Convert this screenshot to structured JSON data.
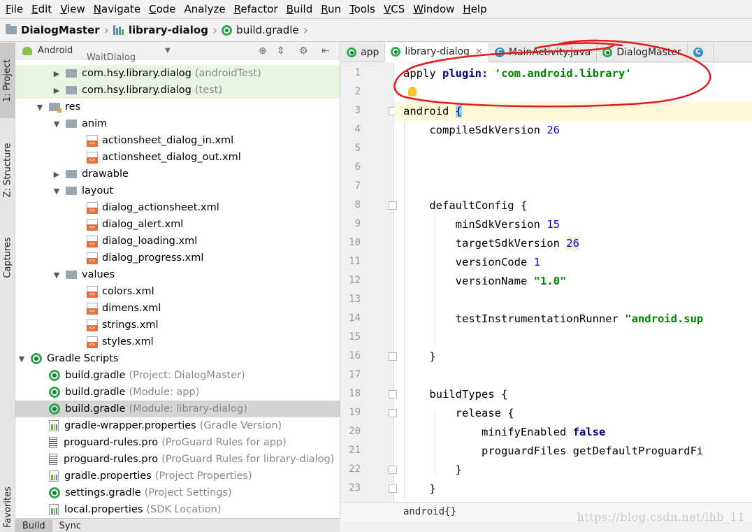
{
  "menu": [
    {
      "label": "File",
      "mnemonic": "F",
      "rest": "ile"
    },
    {
      "label": "Edit",
      "mnemonic": "E",
      "rest": "dit"
    },
    {
      "label": "View",
      "mnemonic": "V",
      "rest": "iew"
    },
    {
      "label": "Navigate",
      "mnemonic": "N",
      "rest": "avigate"
    },
    {
      "label": "Code",
      "mnemonic": "C",
      "rest": "ode"
    },
    {
      "label": "Analyze",
      "mnemonic": "",
      "rest": "Analyze"
    },
    {
      "label": "Refactor",
      "mnemonic": "R",
      "rest": "efactor"
    },
    {
      "label": "Build",
      "mnemonic": "B",
      "rest": "uild"
    },
    {
      "label": "Run",
      "mnemonic": "R",
      "rest": "un"
    },
    {
      "label": "Tools",
      "mnemonic": "T",
      "rest": "ools"
    },
    {
      "label": "VCS",
      "mnemonic": "V",
      "rest": "CS"
    },
    {
      "label": "Window",
      "mnemonic": "W",
      "rest": "indow"
    },
    {
      "label": "Help",
      "mnemonic": "H",
      "rest": "elp"
    }
  ],
  "breadcrumb": {
    "project": "DialogMaster",
    "module": "library-dialog",
    "file": "build.gradle"
  },
  "tool_strip": {
    "project": "1: Project",
    "structure": "Z: Structure",
    "captures": "Captures",
    "favorites": "Favorites"
  },
  "project_panel": {
    "view_mode": "Android",
    "partial_top_item": "WaitDialog",
    "tree": [
      {
        "label": "com.hsy.library.dialog",
        "hint": "(androidTest)",
        "arrow": "▶",
        "indent": 0,
        "icon": "package-folder-icon",
        "style": "green"
      },
      {
        "label": "com.hsy.library.dialog",
        "hint": "(test)",
        "arrow": "▶",
        "indent": 0,
        "icon": "package-folder-icon",
        "style": "green"
      },
      {
        "label": "res",
        "hint": "",
        "arrow": "▼",
        "indent": -1,
        "icon": "res-folder-icon",
        "style": ""
      },
      {
        "label": "anim",
        "hint": "",
        "arrow": "▼",
        "indent": 0,
        "icon": "folder-icon",
        "style": ""
      },
      {
        "label": "actionsheet_dialog_in.xml",
        "hint": "",
        "arrow": "",
        "indent": 1,
        "icon": "xml-file-icon",
        "style": ""
      },
      {
        "label": "actionsheet_dialog_out.xml",
        "hint": "",
        "arrow": "",
        "indent": 1,
        "icon": "xml-file-icon",
        "style": ""
      },
      {
        "label": "drawable",
        "hint": "",
        "arrow": "▶",
        "indent": 0,
        "icon": "folder-icon",
        "style": ""
      },
      {
        "label": "layout",
        "hint": "",
        "arrow": "▼",
        "indent": 0,
        "icon": "folder-icon",
        "style": ""
      },
      {
        "label": "dialog_actionsheet.xml",
        "hint": "",
        "arrow": "",
        "indent": 1,
        "icon": "xml-file-icon",
        "style": ""
      },
      {
        "label": "dialog_alert.xml",
        "hint": "",
        "arrow": "",
        "indent": 1,
        "icon": "xml-file-icon",
        "style": ""
      },
      {
        "label": "dialog_loading.xml",
        "hint": "",
        "arrow": "",
        "indent": 1,
        "icon": "xml-file-icon",
        "style": ""
      },
      {
        "label": "dialog_progress.xml",
        "hint": "",
        "arrow": "",
        "indent": 1,
        "icon": "xml-file-icon",
        "style": ""
      },
      {
        "label": "values",
        "hint": "",
        "arrow": "▼",
        "indent": 0,
        "icon": "folder-icon",
        "style": ""
      },
      {
        "label": "colors.xml",
        "hint": "",
        "arrow": "",
        "indent": 1,
        "icon": "xml-file-icon",
        "style": ""
      },
      {
        "label": "dimens.xml",
        "hint": "",
        "arrow": "",
        "indent": 1,
        "icon": "xml-file-icon",
        "style": ""
      },
      {
        "label": "strings.xml",
        "hint": "",
        "arrow": "",
        "indent": 1,
        "icon": "xml-file-icon",
        "style": ""
      },
      {
        "label": "styles.xml",
        "hint": "",
        "arrow": "",
        "indent": 1,
        "icon": "xml-file-icon",
        "style": ""
      },
      {
        "label": "Gradle Scripts",
        "hint": "",
        "arrow": "▼",
        "indent": -2,
        "icon": "gradle-icon",
        "style": ""
      },
      {
        "label": "build.gradle",
        "hint": "(Project: DialogMaster)",
        "arrow": "",
        "indent": -1,
        "icon": "gradle-icon",
        "style": ""
      },
      {
        "label": "build.gradle",
        "hint": "(Module: app)",
        "arrow": "",
        "indent": -1,
        "icon": "gradle-icon",
        "style": ""
      },
      {
        "label": "build.gradle",
        "hint": "(Module: library-dialog)",
        "arrow": "",
        "indent": -1,
        "icon": "gradle-icon",
        "style": "selected"
      },
      {
        "label": "gradle-wrapper.properties",
        "hint": "(Gradle Version)",
        "arrow": "",
        "indent": -1,
        "icon": "properties-file-icon",
        "style": ""
      },
      {
        "label": "proguard-rules.pro",
        "hint": "(ProGuard Rules for app)",
        "arrow": "",
        "indent": -1,
        "icon": "text-file-icon",
        "style": ""
      },
      {
        "label": "proguard-rules.pro",
        "hint": "(ProGuard Rules for library-dialog)",
        "arrow": "",
        "indent": -1,
        "icon": "text-file-icon",
        "style": ""
      },
      {
        "label": "gradle.properties",
        "hint": "(Project Properties)",
        "arrow": "",
        "indent": -1,
        "icon": "properties-file-icon",
        "style": ""
      },
      {
        "label": "settings.gradle",
        "hint": "(Project Settings)",
        "arrow": "",
        "indent": -1,
        "icon": "gradle-icon",
        "style": ""
      },
      {
        "label": "local.properties",
        "hint": "(SDK Location)",
        "arrow": "",
        "indent": -1,
        "icon": "properties-file-icon",
        "style": ""
      }
    ]
  },
  "bottom_tabs": [
    "Build",
    "Sync"
  ],
  "editor_tabs": [
    {
      "label": "app",
      "icon": "gradle-icon",
      "active": false,
      "closable": false
    },
    {
      "label": "library-dialog",
      "icon": "gradle-icon",
      "active": true,
      "closable": true
    },
    {
      "label": "MainActivity.java",
      "icon": "java-class-icon",
      "active": false,
      "closable": false
    },
    {
      "label": "DialogMaster",
      "icon": "gradle-icon",
      "active": false,
      "closable": false
    },
    {
      "label": "",
      "icon": "java-class-icon",
      "active": false,
      "closable": false
    }
  ],
  "editor": {
    "lines": [
      {
        "n": "1",
        "code": [
          {
            "t": "apply ",
            "c": "plain"
          },
          {
            "t": "plugin: ",
            "c": "kw"
          },
          {
            "t": "'com.android.library'",
            "c": "str"
          }
        ]
      },
      {
        "n": "2",
        "code": []
      },
      {
        "n": "3",
        "code": [
          {
            "t": "android ",
            "c": "plain"
          },
          {
            "t": "{",
            "c": "brace"
          }
        ]
      },
      {
        "n": "4",
        "code": [
          {
            "t": "    compileSdkVersion ",
            "c": "plain"
          },
          {
            "t": "26",
            "c": "num"
          }
        ]
      },
      {
        "n": "5",
        "code": []
      },
      {
        "n": "6",
        "code": []
      },
      {
        "n": "7",
        "code": []
      },
      {
        "n": "8",
        "code": [
          {
            "t": "    defaultConfig {",
            "c": "plain"
          }
        ]
      },
      {
        "n": "9",
        "code": [
          {
            "t": "        minSdkVersion ",
            "c": "plain"
          },
          {
            "t": "15",
            "c": "num"
          }
        ]
      },
      {
        "n": "10",
        "code": [
          {
            "t": "        targetSdkVersion ",
            "c": "plain"
          },
          {
            "t": "26",
            "c": "numhl"
          }
        ]
      },
      {
        "n": "11",
        "code": [
          {
            "t": "        versionCode ",
            "c": "plain"
          },
          {
            "t": "1",
            "c": "num"
          }
        ]
      },
      {
        "n": "12",
        "code": [
          {
            "t": "        versionName ",
            "c": "plain"
          },
          {
            "t": "\"1.0\"",
            "c": "str"
          }
        ]
      },
      {
        "n": "13",
        "code": []
      },
      {
        "n": "14",
        "code": [
          {
            "t": "        testInstrumentationRunner ",
            "c": "plain"
          },
          {
            "t": "\"android.sup",
            "c": "str"
          }
        ]
      },
      {
        "n": "15",
        "code": []
      },
      {
        "n": "16",
        "code": [
          {
            "t": "    }",
            "c": "plain"
          }
        ]
      },
      {
        "n": "17",
        "code": []
      },
      {
        "n": "18",
        "code": [
          {
            "t": "    buildTypes {",
            "c": "plain"
          }
        ]
      },
      {
        "n": "19",
        "code": [
          {
            "t": "        release {",
            "c": "plain"
          }
        ]
      },
      {
        "n": "20",
        "code": [
          {
            "t": "            minifyEnabled ",
            "c": "plain"
          },
          {
            "t": "false",
            "c": "kw"
          }
        ]
      },
      {
        "n": "21",
        "code": [
          {
            "t": "            proguardFiles getDefaultProguardFi",
            "c": "plain"
          }
        ]
      },
      {
        "n": "22",
        "code": [
          {
            "t": "        }",
            "c": "plain"
          }
        ]
      },
      {
        "n": "23",
        "code": [
          {
            "t": "    }",
            "c": "plain"
          }
        ]
      }
    ],
    "footer_breadcrumb": "android{}"
  },
  "watermark": "https://blog.csdn.net/lhb_11",
  "colors": {
    "annotation": "#e8191c",
    "string": "#008000",
    "keyword": "#000080",
    "number": "#0000ff"
  }
}
